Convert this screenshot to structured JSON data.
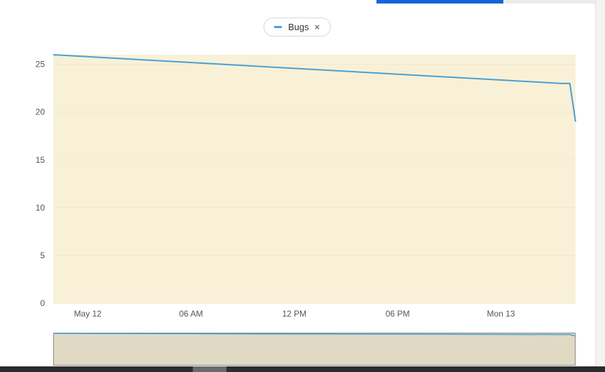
{
  "colors": {
    "series": "#4a9fd4",
    "plot_background": "#f8f1d8",
    "navigator_background": "#e0dac4",
    "accent_bar": "#1664d6"
  },
  "legend": {
    "label": "Bugs",
    "close_icon": "×"
  },
  "chart_data": {
    "type": "line",
    "series": [
      {
        "name": "Bugs",
        "x": [
          "2024-05-11 22:00",
          "2024-05-13 03:30",
          "2024-05-13 04:00",
          "2024-05-13 04:20"
        ],
        "values": [
          26,
          23,
          23,
          19
        ]
      }
    ],
    "x_tick_labels": [
      "May 12",
      "06 AM",
      "12 PM",
      "06 PM",
      "Mon 13"
    ],
    "y_tick_labels": [
      "0",
      "5",
      "10",
      "15",
      "20",
      "25"
    ],
    "ylim": [
      0,
      26
    ],
    "grid": true,
    "legend_position": "top-center",
    "navigator": true
  }
}
